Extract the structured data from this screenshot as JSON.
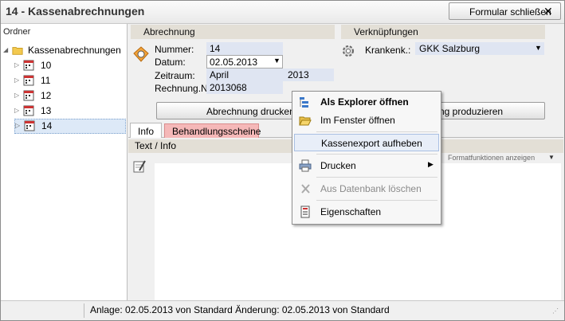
{
  "window": {
    "title": "14 - Kassenabrechnungen",
    "close_label": "Formular schließen",
    "close_glyph": "✕"
  },
  "left": {
    "header": "Ordner",
    "root": "Kassenabrechnungen",
    "items": [
      "10",
      "11",
      "12",
      "13",
      "14"
    ],
    "selected": "14"
  },
  "abrechnung": {
    "title": "Abrechnung",
    "labels": {
      "nummer": "Nummer:",
      "datum": "Datum:",
      "zeitraum": "Zeitraum:",
      "rechnung": "Rechnung.Nr"
    },
    "values": {
      "nummer": "14",
      "datum": "02.05.2013",
      "zeitraum_month": "April",
      "zeitraum_year": "2013",
      "rechnung": "2013068"
    },
    "print_button": "Abrechnung drucken"
  },
  "verknuepfungen": {
    "title": "Verknüpfungen",
    "krank_label": "Krankenk.:",
    "krank_value": "GKK Salzburg",
    "produce_button": "ng produzieren"
  },
  "tabs": [
    {
      "label": "Info"
    },
    {
      "label": "Behandlungsscheine"
    }
  ],
  "textinfo": {
    "header": "Text / Info",
    "format_label": "Formatfunktionen anzeigen"
  },
  "status": {
    "text": "Anlage: 02.05.2013 von Standard  Änderung: 02.05.2013 von Standard"
  },
  "context_menu": {
    "items": [
      {
        "label": "Als Explorer öffnen",
        "icon": "explorer-icon"
      },
      {
        "label": "Im Fenster öffnen",
        "icon": "folder-open-icon"
      },
      {
        "label": "Kassenexport aufheben",
        "icon": ""
      },
      {
        "label": "Drucken",
        "icon": "printer-icon"
      },
      {
        "label": "Aus Datenbank löschen",
        "icon": "delete-icon"
      },
      {
        "label": "Eigenschaften",
        "icon": "properties-icon"
      }
    ]
  },
  "colors": {
    "header_bg": "#e3dfd6",
    "field_bg": "#dfe5f2",
    "tab_red": "#f5b8b8"
  }
}
